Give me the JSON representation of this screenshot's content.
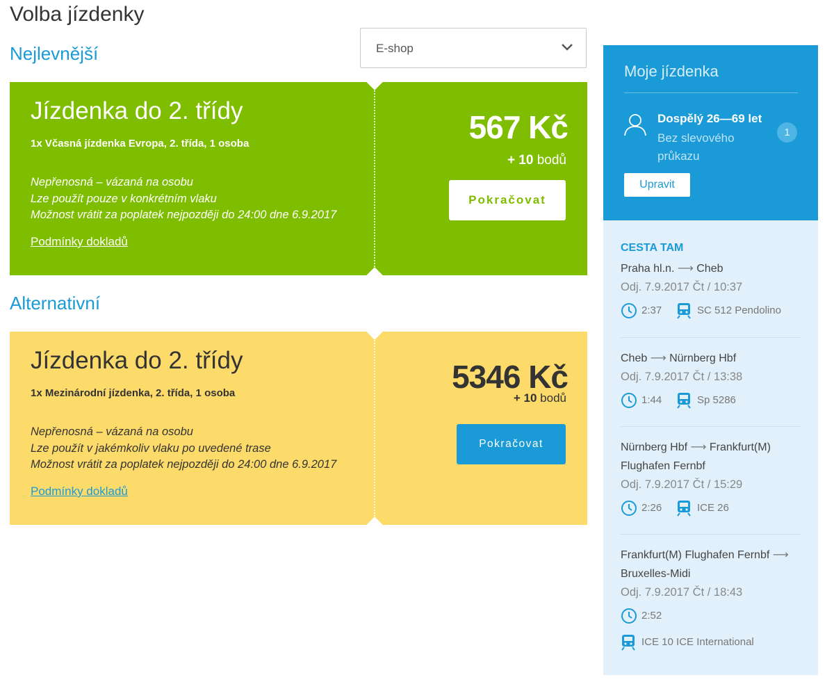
{
  "page_title": "Volba jízdenky",
  "shop_select": {
    "value": "E-shop"
  },
  "sections": {
    "cheapest": "Nejlevnější",
    "alternative": "Alternativní"
  },
  "tickets": [
    {
      "name": "Jízdenka do 2. třídy",
      "description": "1x Včasná jízdenka Evropa, 2. třída, 1 osoba",
      "notes": [
        "Nepřenosná – vázaná na osobu",
        "Lze použít pouze v konkrétním vlaku",
        "Možnost vrátit za poplatek nejpozději do 24:00 dne 6.9.2017"
      ],
      "conditions_link": "Podmínky dokladů",
      "price": "567 Kč",
      "points_prefix": "+ 10",
      "points_suffix": " bodů",
      "button": "Pokračovat",
      "color": "#7fbd00"
    },
    {
      "name": "Jízdenka do 2. třídy",
      "description": "1x Mezinárodní jízdenka, 2. třída, 1 osoba",
      "notes": [
        "Nepřenosná – vázaná na osobu",
        "Lze použít v jakémkoliv vlaku po uvedené trase",
        "Možnost vrátit za poplatek nejpozději do 24:00 dne 6.9.2017"
      ],
      "conditions_link": "Podmínky dokladů",
      "price": "5346 Kč",
      "points_prefix": "+ 10",
      "points_suffix": " bodů",
      "button": "Pokračovat",
      "color": "#fddb6b"
    }
  ],
  "sidebar": {
    "title": "Moje jízdenka",
    "passenger": {
      "title": "Dospělý 26—69 let",
      "subtitle": "Bez slevového průkazu",
      "count": "1"
    },
    "edit_button": "Upravit",
    "direction_label": "CESTA TAM",
    "segments": [
      {
        "from": "Praha hl.n.",
        "to": "Cheb",
        "departure": "Odj. 7.9.2017 Čt / 10:37",
        "duration": "2:37",
        "train": "SC 512 Pendolino"
      },
      {
        "from": "Cheb",
        "to": "Nürnberg Hbf",
        "departure": "Odj. 7.9.2017 Čt / 13:38",
        "duration": "1:44",
        "train": "Sp 5286"
      },
      {
        "from": "Nürnberg Hbf",
        "to": "Frankfurt(M) Flughafen Fernbf",
        "departure": "Odj. 7.9.2017 Čt / 15:29",
        "duration": "2:26",
        "train": "ICE 26"
      },
      {
        "from": "Frankfurt(M) Flughafen Fernbf",
        "to": "Bruxelles-Midi",
        "departure": "Odj. 7.9.2017 Čt / 18:43",
        "duration": "2:52",
        "train": "ICE 10 ICE International"
      }
    ]
  },
  "icons": {
    "dropdown": "chevron-down-icon",
    "passenger": "person-icon",
    "duration": "clock-icon",
    "train": "train-icon",
    "route_arrow": "arrow-right-icon"
  },
  "colors": {
    "accent": "#1a9ad6",
    "green": "#7fbd00",
    "yellow": "#fddb6b",
    "sidebar_bg": "#e1f0fa"
  }
}
